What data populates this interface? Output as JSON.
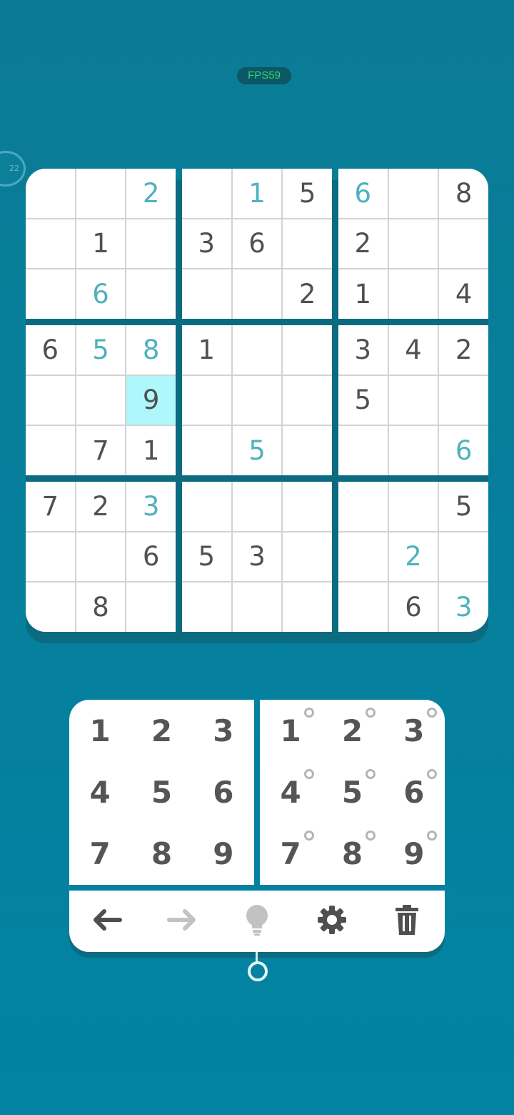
{
  "status": {
    "fps_label": "FPS59",
    "timer_text": "22"
  },
  "colors": {
    "background": "#0283a3",
    "given_digit": "#505050",
    "input_digit": "#4db2bd",
    "selected_cell": "#aef8fc",
    "grid_line": "#d3d3d3"
  },
  "board": {
    "selected": {
      "row": 4,
      "col": 2
    },
    "rows": [
      [
        {
          "v": "",
          "t": "e"
        },
        {
          "v": "",
          "t": "e"
        },
        {
          "v": "2",
          "t": "i"
        },
        {
          "v": "",
          "t": "e"
        },
        {
          "v": "1",
          "t": "i"
        },
        {
          "v": "5",
          "t": "g"
        },
        {
          "v": "6",
          "t": "i"
        },
        {
          "v": "",
          "t": "e"
        },
        {
          "v": "8",
          "t": "g"
        }
      ],
      [
        {
          "v": "",
          "t": "e"
        },
        {
          "v": "1",
          "t": "g"
        },
        {
          "v": "",
          "t": "e"
        },
        {
          "v": "3",
          "t": "g"
        },
        {
          "v": "6",
          "t": "g"
        },
        {
          "v": "",
          "t": "e"
        },
        {
          "v": "2",
          "t": "g"
        },
        {
          "v": "",
          "t": "e"
        },
        {
          "v": "",
          "t": "e"
        }
      ],
      [
        {
          "v": "",
          "t": "e"
        },
        {
          "v": "6",
          "t": "i"
        },
        {
          "v": "",
          "t": "e"
        },
        {
          "v": "",
          "t": "e"
        },
        {
          "v": "",
          "t": "e"
        },
        {
          "v": "2",
          "t": "g"
        },
        {
          "v": "1",
          "t": "g"
        },
        {
          "v": "",
          "t": "e"
        },
        {
          "v": "4",
          "t": "g"
        }
      ],
      [
        {
          "v": "6",
          "t": "g"
        },
        {
          "v": "5",
          "t": "i"
        },
        {
          "v": "8",
          "t": "i"
        },
        {
          "v": "1",
          "t": "g"
        },
        {
          "v": "",
          "t": "e"
        },
        {
          "v": "",
          "t": "e"
        },
        {
          "v": "3",
          "t": "g"
        },
        {
          "v": "4",
          "t": "g"
        },
        {
          "v": "2",
          "t": "g"
        }
      ],
      [
        {
          "v": "",
          "t": "e"
        },
        {
          "v": "",
          "t": "e"
        },
        {
          "v": "9",
          "t": "g"
        },
        {
          "v": "",
          "t": "e"
        },
        {
          "v": "",
          "t": "e"
        },
        {
          "v": "",
          "t": "e"
        },
        {
          "v": "5",
          "t": "g"
        },
        {
          "v": "",
          "t": "e"
        },
        {
          "v": "",
          "t": "e"
        }
      ],
      [
        {
          "v": "",
          "t": "e"
        },
        {
          "v": "7",
          "t": "g"
        },
        {
          "v": "1",
          "t": "g"
        },
        {
          "v": "",
          "t": "e"
        },
        {
          "v": "5",
          "t": "i"
        },
        {
          "v": "",
          "t": "e"
        },
        {
          "v": "",
          "t": "e"
        },
        {
          "v": "",
          "t": "e"
        },
        {
          "v": "6",
          "t": "i"
        }
      ],
      [
        {
          "v": "7",
          "t": "g"
        },
        {
          "v": "2",
          "t": "g"
        },
        {
          "v": "3",
          "t": "i"
        },
        {
          "v": "",
          "t": "e"
        },
        {
          "v": "",
          "t": "e"
        },
        {
          "v": "",
          "t": "e"
        },
        {
          "v": "",
          "t": "e"
        },
        {
          "v": "",
          "t": "e"
        },
        {
          "v": "5",
          "t": "g"
        }
      ],
      [
        {
          "v": "",
          "t": "e"
        },
        {
          "v": "",
          "t": "e"
        },
        {
          "v": "6",
          "t": "g"
        },
        {
          "v": "5",
          "t": "g"
        },
        {
          "v": "3",
          "t": "g"
        },
        {
          "v": "",
          "t": "e"
        },
        {
          "v": "",
          "t": "e"
        },
        {
          "v": "2",
          "t": "i"
        },
        {
          "v": "",
          "t": "e"
        }
      ],
      [
        {
          "v": "",
          "t": "e"
        },
        {
          "v": "8",
          "t": "g"
        },
        {
          "v": "",
          "t": "e"
        },
        {
          "v": "",
          "t": "e"
        },
        {
          "v": "",
          "t": "e"
        },
        {
          "v": "",
          "t": "e"
        },
        {
          "v": "",
          "t": "e"
        },
        {
          "v": "6",
          "t": "g"
        },
        {
          "v": "3",
          "t": "i"
        }
      ]
    ]
  },
  "keypad": {
    "numbers": [
      "1",
      "2",
      "3",
      "4",
      "5",
      "6",
      "7",
      "8",
      "9"
    ],
    "pencil": [
      "1",
      "2",
      "3",
      "4",
      "5",
      "6",
      "7",
      "8",
      "9"
    ]
  },
  "toolbar": [
    {
      "name": "undo-button",
      "icon": "arrow-left-icon",
      "color": "#4f4f4f"
    },
    {
      "name": "redo-button",
      "icon": "arrow-right-icon",
      "color": "#c2c2c2"
    },
    {
      "name": "hint-button",
      "icon": "lightbulb-icon",
      "color": "#c2c2c2"
    },
    {
      "name": "settings-button",
      "icon": "gear-icon",
      "color": "#4f4f4f"
    },
    {
      "name": "erase-button",
      "icon": "trash-icon",
      "color": "#4f4f4f"
    }
  ]
}
